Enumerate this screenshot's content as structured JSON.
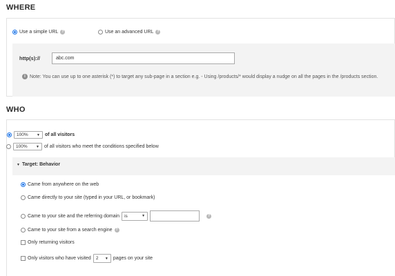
{
  "where": {
    "title": "WHERE",
    "simple_url_label": "Use a simple URL",
    "advanced_url_label": "Use an advanced URL",
    "protocol_label": "http(s)://",
    "url_value": "abc.com",
    "note": "Note: You can use up to one asterisk (*) to target any sub-page in a section e.g. - Using /products/* would display a nudge on all the pages in the /products section."
  },
  "who": {
    "title": "WHO",
    "option1": {
      "percent": "100%",
      "label": "of all visitors"
    },
    "option2": {
      "percent": "100%",
      "label": "of all visitors who meet the conditions specified below"
    },
    "target_title": "Target: Behavior",
    "conditions": {
      "anywhere": "Came from anywhere on the web",
      "direct": "Came directly to your site (typed in your URL, or bookmark)",
      "referring_prefix": "Came to your site and the referring domain",
      "referring_operator": "is",
      "search_engine": "Came to your site from a search engine",
      "returning": "Only returning visitors",
      "visited_prefix": "Only visitors who have visited",
      "visited_count": "2",
      "visited_suffix": "pages on your site"
    }
  },
  "icons": {
    "help": "?",
    "info": "i",
    "caret": "▼",
    "collapse": "▼"
  }
}
